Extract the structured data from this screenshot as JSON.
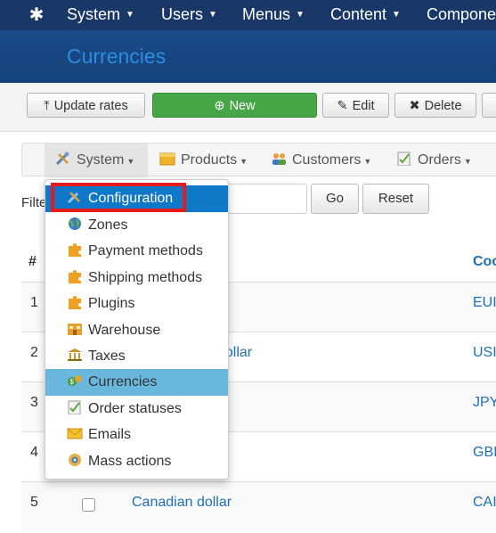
{
  "topbar": {
    "items": [
      "System",
      "Users",
      "Menus",
      "Content",
      "Compone"
    ]
  },
  "header": {
    "title": "Currencies"
  },
  "toolbar": {
    "update_rates": "Update rates",
    "new": "New",
    "edit": "Edit",
    "delete": "Delete"
  },
  "menubar": {
    "items": [
      "System",
      "Products",
      "Customers",
      "Orders"
    ]
  },
  "filter": {
    "label": "Filte",
    "go": "Go",
    "reset": "Reset"
  },
  "table": {
    "col_num": "#",
    "col_code": "Coc",
    "rows": [
      {
        "num": "1",
        "name": "",
        "code": "EUI"
      },
      {
        "num": "2",
        "name": "dollar",
        "code": "USI"
      },
      {
        "num": "3",
        "name": "",
        "code": "JPY"
      },
      {
        "num": "4",
        "name": "",
        "code": "GBI"
      },
      {
        "num": "5",
        "name": "Canadian dollar",
        "code": "CAI"
      }
    ]
  },
  "dropdown": {
    "items": [
      {
        "label": "Configuration",
        "icon": "wrench-icon",
        "state": "active"
      },
      {
        "label": "Zones",
        "icon": "globe-icon",
        "state": ""
      },
      {
        "label": "Payment methods",
        "icon": "puzzle-icon",
        "state": ""
      },
      {
        "label": "Shipping methods",
        "icon": "puzzle-icon",
        "state": ""
      },
      {
        "label": "Plugins",
        "icon": "puzzle-icon",
        "state": ""
      },
      {
        "label": "Warehouse",
        "icon": "warehouse-icon",
        "state": ""
      },
      {
        "label": "Taxes",
        "icon": "bank-icon",
        "state": ""
      },
      {
        "label": "Currencies",
        "icon": "money-icon",
        "state": "highlight"
      },
      {
        "label": "Order statuses",
        "icon": "checklist-icon",
        "state": ""
      },
      {
        "label": "Emails",
        "icon": "envelope-icon",
        "state": ""
      },
      {
        "label": "Mass actions",
        "icon": "gears-icon",
        "state": ""
      }
    ]
  },
  "colors": {
    "topbar": "#1a3867",
    "title": "#2a8de0",
    "new_button": "#46a546",
    "highlight": "#6ab7dd",
    "active": "#0f78c8",
    "annotation": "#e51b1b",
    "link": "#1f6fb5"
  }
}
